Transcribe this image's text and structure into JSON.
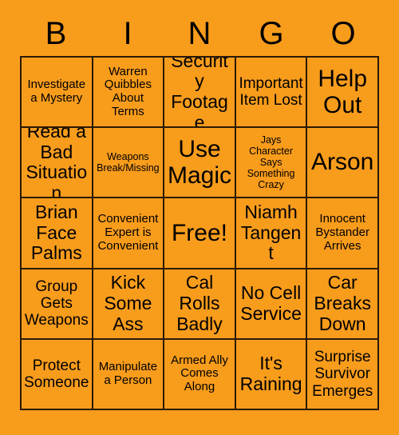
{
  "card": {
    "type": "bingo-card",
    "background_color": "#f89c1c",
    "border_color": "#2b1a05",
    "text_color": "#000000",
    "grid_size": "5x5"
  },
  "header": {
    "letters": [
      "B",
      "I",
      "N",
      "G",
      "O"
    ]
  },
  "grid": {
    "rows": [
      [
        {
          "text": "Investigate a Mystery",
          "size": "fs-sm"
        },
        {
          "text": "Warren Quibbles About Terms",
          "size": "fs-sm"
        },
        {
          "text": "Security Footage",
          "size": "fs-lg"
        },
        {
          "text": "Important Item Lost",
          "size": "fs-md"
        },
        {
          "text": "Help Out",
          "size": "fs-xl"
        }
      ],
      [
        {
          "text": "Read a Bad Situation",
          "size": "fs-lg"
        },
        {
          "text": "Weapons Break/Missing",
          "size": "fs-xs"
        },
        {
          "text": "Use Magic",
          "size": "fs-xl"
        },
        {
          "text": "Jays Character Says Something Crazy",
          "size": "fs-xs"
        },
        {
          "text": "Arson",
          "size": "fs-xl"
        }
      ],
      [
        {
          "text": "Brian Face Palms",
          "size": "fs-lg"
        },
        {
          "text": "Convenient Expert is Convenient",
          "size": "fs-sm"
        },
        {
          "text": "Free!",
          "size": "fs-xl"
        },
        {
          "text": "Niamh Tangent",
          "size": "fs-lg"
        },
        {
          "text": "Innocent Bystander Arrives",
          "size": "fs-sm"
        }
      ],
      [
        {
          "text": "Group Gets Weapons",
          "size": "fs-md"
        },
        {
          "text": "Kick Some Ass",
          "size": "fs-lg"
        },
        {
          "text": "Cal Rolls Badly",
          "size": "fs-lg"
        },
        {
          "text": "No Cell Service",
          "size": "fs-lg"
        },
        {
          "text": "Car Breaks Down",
          "size": "fs-lg"
        }
      ],
      [
        {
          "text": "Protect Someone",
          "size": "fs-md"
        },
        {
          "text": "Manipulate a Person",
          "size": "fs-sm"
        },
        {
          "text": "Armed Ally Comes Along",
          "size": "fs-sm"
        },
        {
          "text": "It's Raining",
          "size": "fs-lg"
        },
        {
          "text": "Surprise Survivor Emerges",
          "size": "fs-md"
        }
      ]
    ]
  }
}
